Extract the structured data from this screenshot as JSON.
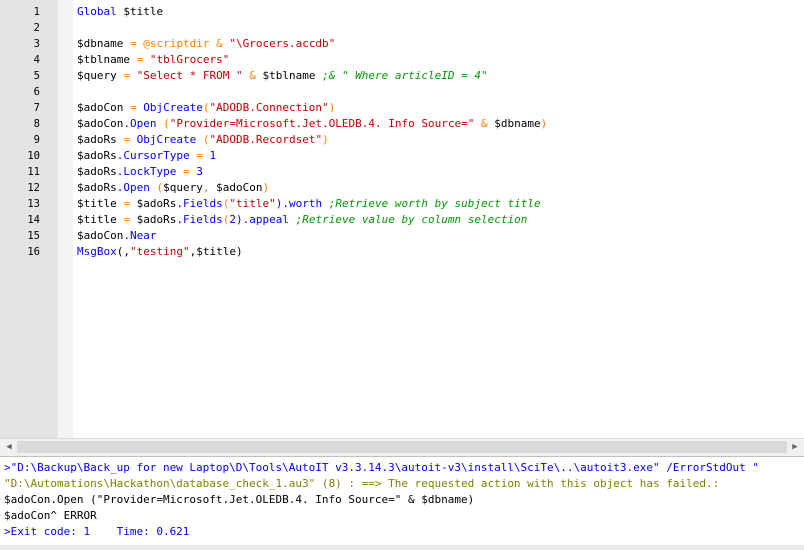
{
  "editor": {
    "lines": [
      {
        "n": "1",
        "segs": [
          {
            "t": "Global ",
            "c": "kw"
          },
          {
            "t": "$title",
            "c": "var"
          }
        ]
      },
      {
        "n": "2",
        "segs": []
      },
      {
        "n": "3",
        "segs": [
          {
            "t": "$dbname",
            "c": "var"
          },
          {
            "t": " = ",
            "c": "op"
          },
          {
            "t": "@scriptdir",
            "c": "macro"
          },
          {
            "t": " & ",
            "c": "op"
          },
          {
            "t": "\"\\Grocers.accdb\"",
            "c": "str"
          }
        ]
      },
      {
        "n": "4",
        "segs": [
          {
            "t": "$tblname",
            "c": "var"
          },
          {
            "t": " = ",
            "c": "op"
          },
          {
            "t": "\"tblGrocers\"",
            "c": "str"
          }
        ]
      },
      {
        "n": "5",
        "segs": [
          {
            "t": "$query",
            "c": "var"
          },
          {
            "t": " = ",
            "c": "op"
          },
          {
            "t": "\"Select * FROM \"",
            "c": "str"
          },
          {
            "t": " & ",
            "c": "op"
          },
          {
            "t": "$tblname",
            "c": "var"
          },
          {
            "t": " ;& \" Where articleID = 4\"",
            "c": "cmt"
          }
        ]
      },
      {
        "n": "6",
        "segs": []
      },
      {
        "n": "7",
        "segs": [
          {
            "t": "$adoCon",
            "c": "var"
          },
          {
            "t": " = ",
            "c": "op"
          },
          {
            "t": "ObjCreate",
            "c": "fn"
          },
          {
            "t": "(",
            "c": "op"
          },
          {
            "t": "\"ADODB.Connection\"",
            "c": "str"
          },
          {
            "t": ")",
            "c": "op"
          }
        ]
      },
      {
        "n": "8",
        "segs": [
          {
            "t": "$adoCon",
            "c": "var"
          },
          {
            "t": ".Open",
            "c": "prop"
          },
          {
            "t": " (",
            "c": "op"
          },
          {
            "t": "\"Provider=Microsoft.Jet.OLEDB.4. Info Source=\"",
            "c": "str"
          },
          {
            "t": " & ",
            "c": "op"
          },
          {
            "t": "$dbname",
            "c": "var"
          },
          {
            "t": ")",
            "c": "op"
          }
        ]
      },
      {
        "n": "9",
        "segs": [
          {
            "t": "$adoRs",
            "c": "var"
          },
          {
            "t": " = ",
            "c": "op"
          },
          {
            "t": "ObjCreate",
            "c": "fn"
          },
          {
            "t": " (",
            "c": "op"
          },
          {
            "t": "\"ADODB.Recordset\"",
            "c": "str"
          },
          {
            "t": ")",
            "c": "op"
          }
        ]
      },
      {
        "n": "10",
        "segs": [
          {
            "t": "$adoRs",
            "c": "var"
          },
          {
            "t": ".CursorType",
            "c": "prop"
          },
          {
            "t": " = ",
            "c": "op"
          },
          {
            "t": "1",
            "c": "num"
          }
        ]
      },
      {
        "n": "11",
        "segs": [
          {
            "t": "$adoRs",
            "c": "var"
          },
          {
            "t": ".LockType",
            "c": "prop"
          },
          {
            "t": " = ",
            "c": "op"
          },
          {
            "t": "3",
            "c": "num"
          }
        ]
      },
      {
        "n": "12",
        "segs": [
          {
            "t": "$adoRs",
            "c": "var"
          },
          {
            "t": ".Open",
            "c": "prop"
          },
          {
            "t": " (",
            "c": "op"
          },
          {
            "t": "$query",
            "c": "var"
          },
          {
            "t": ", ",
            "c": "op"
          },
          {
            "t": "$adoCon",
            "c": "var"
          },
          {
            "t": ")",
            "c": "op"
          }
        ]
      },
      {
        "n": "13",
        "segs": [
          {
            "t": "$title",
            "c": "var"
          },
          {
            "t": " = ",
            "c": "op"
          },
          {
            "t": "$adoRs",
            "c": "var"
          },
          {
            "t": ".Fields",
            "c": "prop"
          },
          {
            "t": "(",
            "c": "op"
          },
          {
            "t": "\"title\"",
            "c": "str"
          },
          {
            "t": ").worth",
            "c": "prop"
          },
          {
            "t": " ;Retrieve worth by subject title",
            "c": "cmt"
          }
        ]
      },
      {
        "n": "14",
        "segs": [
          {
            "t": "$title",
            "c": "var"
          },
          {
            "t": " = ",
            "c": "op"
          },
          {
            "t": "$adoRs",
            "c": "var"
          },
          {
            "t": ".Fields",
            "c": "prop"
          },
          {
            "t": "(",
            "c": "op"
          },
          {
            "t": "2",
            "c": "num"
          },
          {
            "t": ").appeal",
            "c": "prop"
          },
          {
            "t": " ;Retrieve value by column selection",
            "c": "cmt"
          }
        ]
      },
      {
        "n": "15",
        "segs": [
          {
            "t": "$adoCon",
            "c": "var"
          },
          {
            "t": ".Near",
            "c": "prop"
          }
        ]
      },
      {
        "n": "16",
        "segs": [
          {
            "t": "MsgBox",
            "c": "fn"
          },
          {
            "t": "(,",
            "c": "plain"
          },
          {
            "t": "\"testing\"",
            "c": "str"
          },
          {
            "t": ",",
            "c": "plain"
          },
          {
            "t": "$title",
            "c": "var"
          },
          {
            "t": ")",
            "c": "plain"
          }
        ]
      }
    ]
  },
  "output": {
    "lines": [
      {
        "text": ">\"D:\\Backup\\Back_up for new Laptop\\D\\Tools\\AutoIT v3.3.14.3\\autoit-v3\\install\\SciTe\\..\\autoit3.exe\" /ErrorStdOut \"",
        "color": "#0000ff"
      },
      {
        "text": "\"D:\\Automations\\Hackathon\\database_check_1.au3\" (8) : ==> The requested action with this object has failed.:",
        "color": "#808000"
      },
      {
        "text": "$adoCon.Open (\"Provider=Microsoft.Jet.OLEDB.4. Info Source=\" & $dbname)",
        "color": "#000000"
      },
      {
        "text": "$adoCon^ ERROR",
        "color": "#000000"
      },
      {
        "text": ">Exit code: 1    Time: 0.621",
        "color": "#0000ff"
      }
    ]
  },
  "scrollbar": {
    "left_arrow": "◀",
    "right_arrow": "▶"
  }
}
